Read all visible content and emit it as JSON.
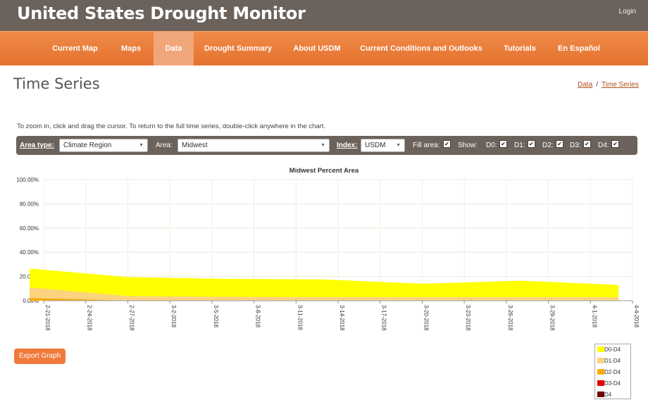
{
  "header": {
    "site_title": "United States Drought Monitor",
    "login_label": "Login"
  },
  "nav": {
    "items": [
      {
        "label": "Current Map"
      },
      {
        "label": "Maps"
      },
      {
        "label": "Data",
        "active": true
      },
      {
        "label": "Drought Summary"
      },
      {
        "label": "About USDM"
      },
      {
        "label": "Current Conditions and Outlooks"
      },
      {
        "label": "Tutorials"
      },
      {
        "label": "En Español"
      }
    ]
  },
  "page": {
    "title": "Time Series",
    "breadcrumb": [
      "Data",
      "Time Series"
    ],
    "breadcrumb_sep": "/",
    "hint": "To zoom in, click and drag the cursor. To return to the full time series, double-click anywhere in the chart."
  },
  "controls": {
    "area_type_label": "Area type:",
    "area_type_value": "Climate Region",
    "area_label": "Area:",
    "area_value": "Midwest",
    "index_label": "Index:",
    "index_value": "USDM",
    "fill_area_label": "Fill area:",
    "show_label": "Show:",
    "d0_label": "D0:",
    "d1_label": "D1:",
    "d2_label": "D2:",
    "d3_label": "D3:",
    "d4_label": "D4:",
    "checked_mark": "✔"
  },
  "export_label": "Export Graph",
  "chart_data": {
    "type": "area",
    "title": "Midwest Percent Area",
    "ylim": [
      0,
      100
    ],
    "y_ticks": [
      "0.00%",
      "20.00%",
      "40.00%",
      "60.00%",
      "80.00%",
      "100.00%"
    ],
    "x_tick_labels": [
      "2-21-2018",
      "2-24-2018",
      "2-27-2018",
      "3-2-2018",
      "3-5-2018",
      "3-8-2018",
      "3-11-2018",
      "3-14-2018",
      "3-17-2018",
      "3-20-2018",
      "3-23-2018",
      "3-26-2018",
      "3-29-2018",
      "4-1-2018",
      "4-4-2018"
    ],
    "x": [
      "2-20-2018",
      "2-27-2018",
      "3-6-2018",
      "3-13-2018",
      "3-20-2018",
      "3-27-2018",
      "4-3-2018"
    ],
    "series": [
      {
        "name": "D0-D4",
        "color": "#ffff00",
        "values": [
          26.5,
          19.5,
          18.0,
          17.5,
          14.0,
          16.5,
          13.0
        ]
      },
      {
        "name": "D1-D4",
        "color": "#fcd37f",
        "values": [
          11.0,
          3.8,
          3.2,
          3.0,
          2.9,
          2.9,
          2.9
        ]
      },
      {
        "name": "D2-D4",
        "color": "#ffaa00",
        "values": [
          2.2,
          0.0,
          0.0,
          0.0,
          0.0,
          0.0,
          0.0
        ]
      },
      {
        "name": "D3-D4",
        "color": "#e60000",
        "values": [
          0.0,
          0.0,
          0.0,
          0.0,
          0.0,
          0.0,
          0.0
        ]
      },
      {
        "name": "D4",
        "color": "#730000",
        "values": [
          0.0,
          0.0,
          0.0,
          0.0,
          0.0,
          0.0,
          0.0
        ]
      }
    ],
    "grid": true,
    "legend_position": "bottom-right"
  }
}
